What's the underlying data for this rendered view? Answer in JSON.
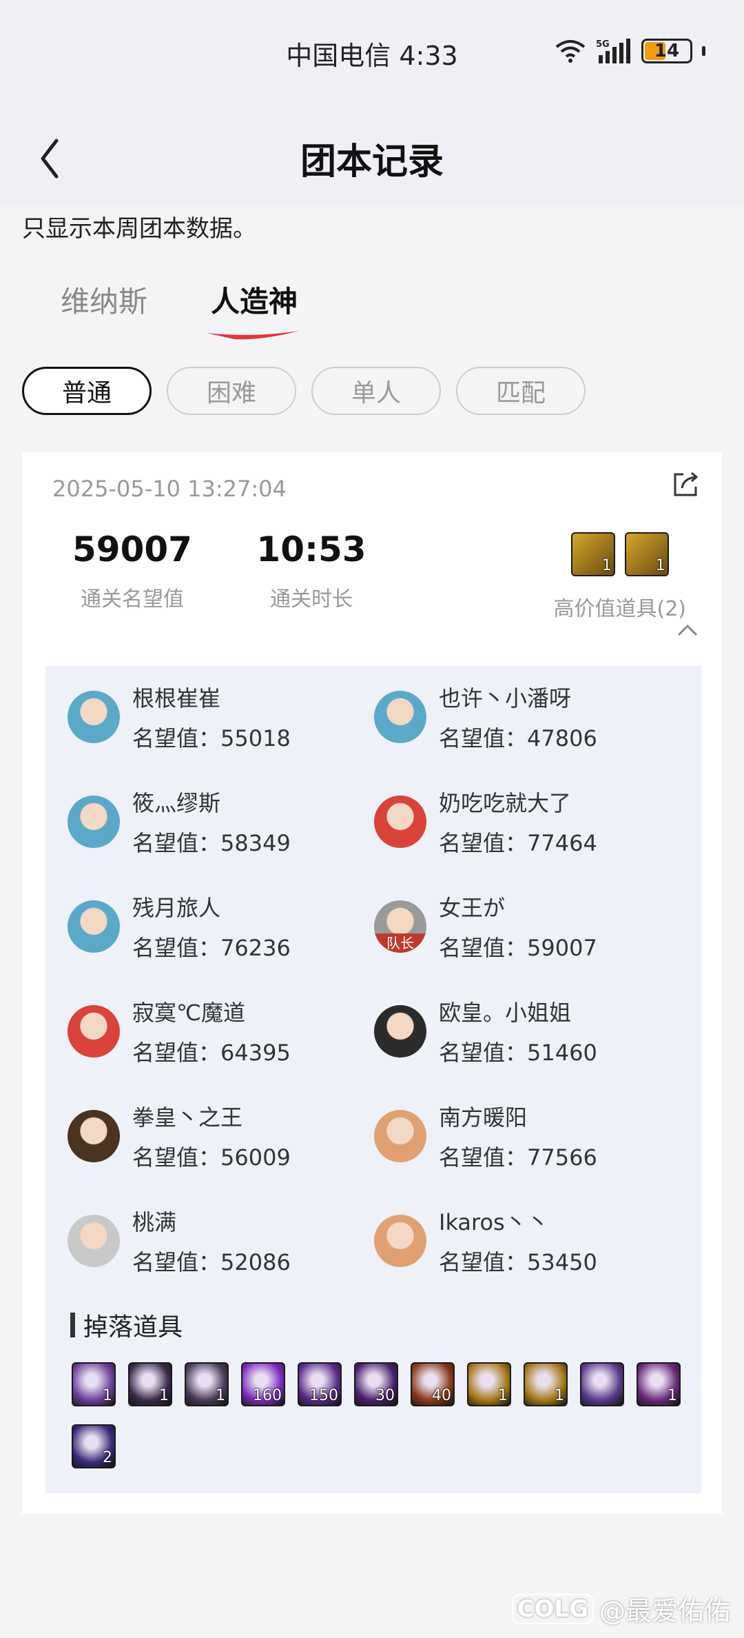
{
  "status": {
    "carrier_time": "中国电信 4:33",
    "network": "5G",
    "battery": "14"
  },
  "header": {
    "title": "团本记录"
  },
  "notice": "只显示本周团本数据。",
  "tabs": [
    {
      "label": "维纳斯"
    },
    {
      "label": "人造神"
    }
  ],
  "chips": [
    {
      "label": "普通"
    },
    {
      "label": "困难"
    },
    {
      "label": "单人"
    },
    {
      "label": "匹配"
    }
  ],
  "record": {
    "datetime": "2025-05-10 13:27:04",
    "reputation_value": "59007",
    "reputation_label": "通关名望值",
    "duration_value": "10:53",
    "duration_label": "通关时长",
    "high_value_label": "高价值道具(2)",
    "high_value_counts": [
      "1",
      "1"
    ]
  },
  "players": [
    {
      "name": "根根崔崔",
      "rep": "名望值：55018",
      "avatar_color": "#5aa9c9"
    },
    {
      "name": "也许丶小潘呀",
      "rep": "名望值：47806",
      "avatar_color": "#5aa9c9"
    },
    {
      "name": "筱灬缪斯",
      "rep": "名望值：58349",
      "avatar_color": "#5aa9c9"
    },
    {
      "name": "奶吃吃就大了",
      "rep": "名望值：77464",
      "avatar_color": "#d9433a"
    },
    {
      "name": "残月旅人",
      "rep": "名望值：76236",
      "avatar_color": "#5aa9c9"
    },
    {
      "name": "女王が",
      "rep": "名望值：59007",
      "avatar_color": "#9a9a9a",
      "leader": "队长"
    },
    {
      "name": "寂寞℃魔道",
      "rep": "名望值：64395",
      "avatar_color": "#d9433a"
    },
    {
      "name": "欧皇。小姐姐",
      "rep": "名望值：51460",
      "avatar_color": "#2b2b2b"
    },
    {
      "name": "拳皇丶之王",
      "rep": "名望值：56009",
      "avatar_color": "#4a3320"
    },
    {
      "name": "南方暖阳",
      "rep": "名望值：77566",
      "avatar_color": "#e0a070"
    },
    {
      "name": "桃满",
      "rep": "名望值：52086",
      "avatar_color": "#c9c9c9"
    },
    {
      "name": "Ikaros丶丶",
      "rep": "名望值：53450",
      "avatar_color": "#e0a070"
    }
  ],
  "drops": {
    "title": "掉落道具",
    "items": [
      {
        "count": "1",
        "color": "#6d3f9a"
      },
      {
        "count": "1",
        "color": "#3a2a4a"
      },
      {
        "count": "1",
        "color": "#4a3a5a"
      },
      {
        "count": "160",
        "color": "#7b2cbf"
      },
      {
        "count": "150",
        "color": "#5a2a8a"
      },
      {
        "count": "30",
        "color": "#4b1f6f"
      },
      {
        "count": "40",
        "color": "#8a3a1a"
      },
      {
        "count": "1",
        "color": "#a6791a"
      },
      {
        "count": "1",
        "color": "#a6791a"
      },
      {
        "count": "",
        "color": "#5b3a8c"
      },
      {
        "count": "1",
        "color": "#6a2a7a"
      },
      {
        "count": "2",
        "color": "#3a2a7a"
      }
    ]
  },
  "watermark": {
    "logo": "COLG",
    "text": "@最爱佑佑"
  },
  "colors": {
    "accent": "#e8323c",
    "gold": "#b8860b"
  }
}
